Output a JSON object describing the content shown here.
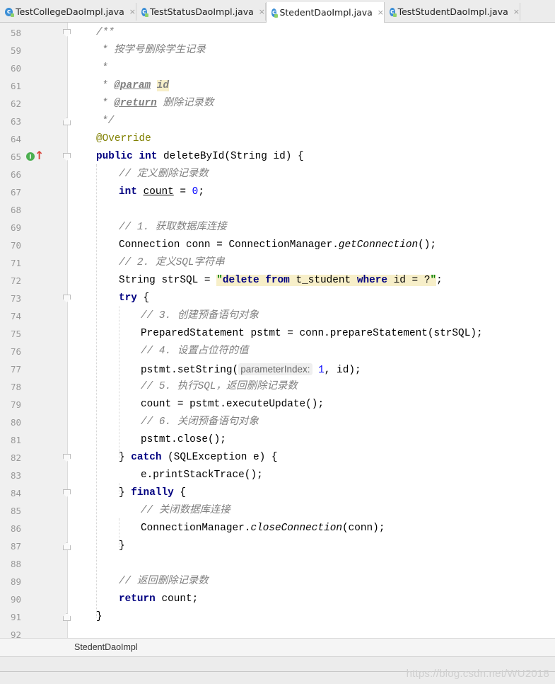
{
  "tabs": [
    {
      "label": "TestCollegeDaoImpl.java",
      "active": false
    },
    {
      "label": "TestStatusDaoImpl.java",
      "active": false
    },
    {
      "label": "StedentDaoImpl.java",
      "active": true
    },
    {
      "label": "TestStudentDaoImpl.java",
      "active": false
    }
  ],
  "tab_close_glyph": "×",
  "line_numbers": [
    "58",
    "59",
    "60",
    "61",
    "62",
    "63",
    "64",
    "65",
    "66",
    "67",
    "68",
    "69",
    "70",
    "71",
    "72",
    "73",
    "74",
    "75",
    "76",
    "77",
    "78",
    "79",
    "80",
    "81",
    "82",
    "83",
    "84",
    "85",
    "86",
    "87",
    "88",
    "89",
    "90",
    "91",
    "92"
  ],
  "code": {
    "l58": "/**",
    "l59": "* 按学号删除学生记录",
    "l60": "*",
    "l61_tag": "@param",
    "l61_id": "id",
    "l62_tag": "@return",
    "l62_text": "删除记录数",
    "l63": "*/",
    "l64": "@Override",
    "l65_kw1": "public",
    "l65_kw2": "int",
    "l65_rest": "deleteById(String id) {",
    "l66": "// 定义删除记录数",
    "l67_kw": "int",
    "l67_var": "count",
    "l67_eq": " = ",
    "l67_num": "0",
    "l67_end": ";",
    "l69": "// 1. 获取数据库连接",
    "l70_pre": "Connection conn = ConnectionManager.",
    "l70_it": "getConnection",
    "l70_end": "();",
    "l71": "// 2. 定义SQL字符串",
    "l72_pre": "String strSQL = ",
    "l72_q": "\"",
    "l72_kw1": "delete from",
    "l72_mid": " t_student ",
    "l72_kw2": "where",
    "l72_tail": " id = ?",
    "l72_q2": "\"",
    "l72_end": ";",
    "l73_kw": "try",
    "l73_rest": " {",
    "l74": "// 3. 创建预备语句对象",
    "l75": "PreparedStatement pstmt = conn.prepareStatement(strSQL);",
    "l76": "// 4. 设置占位符的值",
    "l77_pre": "pstmt.setString(",
    "l77_hint": "parameterIndex:",
    "l77_num": "1",
    "l77_end": ", id);",
    "l78": "// 5. 执行SQL，返回删除记录数",
    "l79": "count = pstmt.executeUpdate();",
    "l80": "// 6. 关闭预备语句对象",
    "l81": "pstmt.close();",
    "l82_pre": "} ",
    "l82_kw": "catch",
    "l82_rest": " (SQLException e) {",
    "l83": "e.printStackTrace();",
    "l84_pre": "} ",
    "l84_kw": "finally",
    "l84_rest": " {",
    "l85": "// 关闭数据库连接",
    "l86_pre": "ConnectionManager.",
    "l86_it": "closeConnection",
    "l86_end": "(conn);",
    "l87": "}",
    "l89": "// 返回删除记录数",
    "l90_kw": "return",
    "l90_rest": " count;",
    "l91": "}"
  },
  "gutter_icons": {
    "implements_marker": "I",
    "arrow": "↑"
  },
  "breadcrumb": "StedentDaoImpl",
  "watermark": "https://blog.csdn.net/WU2018"
}
